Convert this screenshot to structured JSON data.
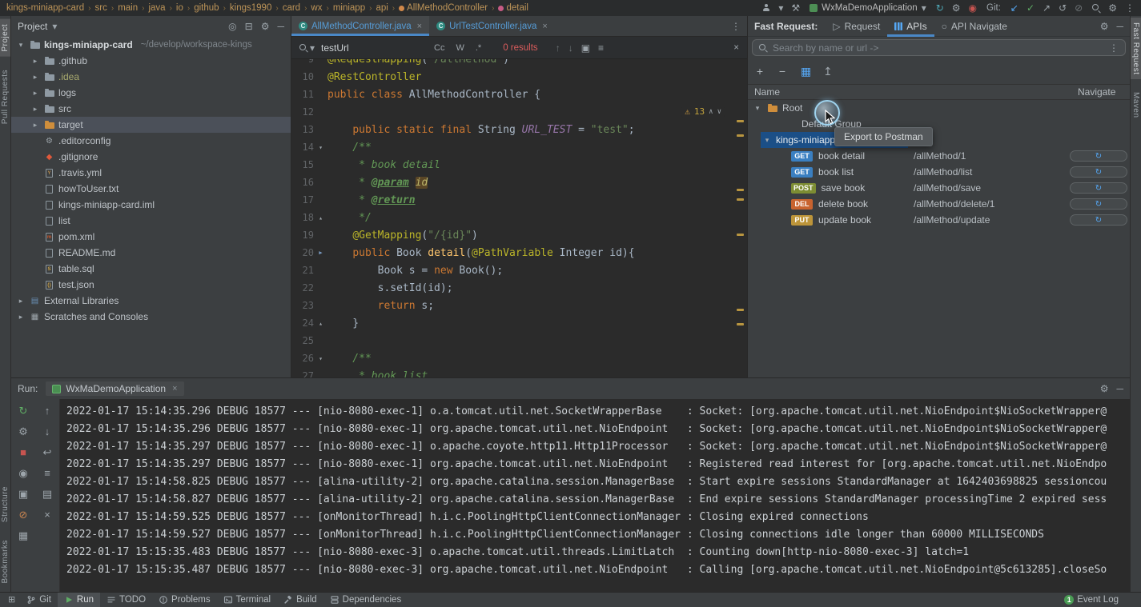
{
  "topbar": {
    "breadcrumbs": [
      {
        "label": "kings-miniapp-card"
      },
      {
        "label": "src"
      },
      {
        "label": "main"
      },
      {
        "label": "java"
      },
      {
        "label": "io"
      },
      {
        "label": "github"
      },
      {
        "label": "kings1990"
      },
      {
        "label": "card"
      },
      {
        "label": "wx"
      },
      {
        "label": "miniapp"
      },
      {
        "label": "api"
      },
      {
        "label": "AllMethodController",
        "dot": "#d0884a"
      },
      {
        "label": "detail",
        "dot": "#c75b84"
      }
    ],
    "run_config": "WxMaDemoApplication",
    "git_label": "Git:",
    "icons_before": [
      {
        "name": "user-icon",
        "shape": "user"
      },
      {
        "name": "chevron-down-icon",
        "glyph": "▾",
        "color": "#9da5ab"
      },
      {
        "name": "build-hammer-icon",
        "glyph": "⚒",
        "color": "#9da5ab"
      }
    ],
    "icons_after": [
      {
        "name": "sync-icon",
        "glyph": "↻",
        "color": "#4ea7b5"
      },
      {
        "name": "services-icon",
        "glyph": "⚙",
        "color": "#9da5ab"
      },
      {
        "name": "profiler-icon",
        "glyph": "◉",
        "color": "#c75450"
      }
    ],
    "git_icons": [
      {
        "name": "git-update-icon",
        "glyph": "↙",
        "color": "#56a8f5"
      },
      {
        "name": "git-commit-icon",
        "glyph": "✓",
        "color": "#5fad65"
      },
      {
        "name": "git-push-icon",
        "glyph": "↗",
        "color": "#9da5ab"
      },
      {
        "name": "git-rollback-icon",
        "glyph": "↺",
        "color": "#9da5ab"
      },
      {
        "name": "git-shelve-icon",
        "glyph": "⊘",
        "color": "#6e7477"
      }
    ],
    "far_icons": [
      {
        "name": "search-icon",
        "shape": "search"
      },
      {
        "name": "settings-icon",
        "glyph": "⚙",
        "color": "#9da5ab"
      },
      {
        "name": "menu-kebab-icon",
        "glyph": "⋮",
        "color": "#9da5ab"
      }
    ]
  },
  "left_strip": {
    "top": [
      {
        "label": "Project",
        "active": true
      },
      {
        "label": "Pull Requests"
      }
    ],
    "bottom": [
      {
        "label": "Structure"
      },
      {
        "label": "Bookmarks"
      }
    ]
  },
  "right_strip": {
    "top": [
      {
        "label": "Fast Request",
        "active": true
      },
      {
        "label": "Maven"
      }
    ]
  },
  "project": {
    "title": "Project",
    "header_icons": [
      {
        "name": "locate-file-icon",
        "glyph": "◎",
        "color": "#9da5ab"
      },
      {
        "name": "collapse-all-icon",
        "glyph": "⊟",
        "color": "#9da5ab"
      },
      {
        "name": "settings-icon",
        "glyph": "⚙",
        "color": "#9da5ab"
      },
      {
        "name": "hide-panel-icon",
        "glyph": "─",
        "color": "#9da5ab"
      }
    ],
    "items": [
      {
        "label": "kings-miniapp-card",
        "path": "~/develop/workspace-kings",
        "icon": "folder",
        "iconColor": "#8f9aa3",
        "chevron": true,
        "open": true,
        "indent": 0,
        "bold": true
      },
      {
        "label": ".github",
        "icon": "folder",
        "chevron": true,
        "indent": 1
      },
      {
        "label": ".idea",
        "icon": "folder",
        "chevron": true,
        "indent": 1,
        "labelColor": "#a8a96e"
      },
      {
        "label": "logs",
        "icon": "folder",
        "chevron": true,
        "indent": 1
      },
      {
        "label": "src",
        "icon": "folder",
        "chevron": true,
        "indent": 1
      },
      {
        "label": "target",
        "icon": "folder",
        "iconColor": "#cf8e3c",
        "chevron": true,
        "indent": 1,
        "selected": true
      },
      {
        "label": ".editorconfig",
        "icon": "gear",
        "indent": 1
      },
      {
        "label": ".gitignore",
        "icon": "git",
        "indent": 1
      },
      {
        "label": ".travis.yml",
        "icon": "file",
        "letter": "Y",
        "letterColor": "#b5894a",
        "indent": 1
      },
      {
        "label": "howToUser.txt",
        "icon": "file",
        "indent": 1
      },
      {
        "label": "kings-miniapp-card.iml",
        "icon": "file",
        "indent": 1
      },
      {
        "label": "list",
        "icon": "file",
        "indent": 1
      },
      {
        "label": "pom.xml",
        "icon": "file",
        "letter": "m",
        "letterColor": "#cc5629",
        "indent": 1
      },
      {
        "label": "README.md",
        "icon": "file",
        "indent": 1
      },
      {
        "label": "table.sql",
        "icon": "file",
        "letter": "S",
        "letterColor": "#c9a24a",
        "indent": 1
      },
      {
        "label": "test.json",
        "icon": "file",
        "letter": "{}",
        "letterColor": "#c9a24a",
        "indent": 1
      },
      {
        "label": "External Libraries",
        "icon": "lib",
        "chevron": true,
        "indent": 0
      },
      {
        "label": "Scratches and Consoles",
        "icon": "scratch",
        "chevron": true,
        "indent": 0
      }
    ]
  },
  "editor": {
    "tabs": [
      {
        "label": "AllMethodController.java",
        "active": true
      },
      {
        "label": "UrlTestController.java",
        "active": false
      }
    ],
    "find": {
      "query": "testUrl",
      "match_case": "Cc",
      "words": "W",
      "regex": ".*",
      "results": "0 results"
    },
    "find_icons_left": [
      {
        "name": "search-icon",
        "shape": "search"
      },
      {
        "name": "search-history-icon",
        "glyph": "▾",
        "color": "#9da5ab"
      }
    ],
    "find_icons_right": [
      {
        "name": "prev-match-icon",
        "glyph": "↑",
        "color": "#6e7478"
      },
      {
        "name": "next-match-icon",
        "glyph": "↓",
        "color": "#6e7478"
      },
      {
        "name": "find-in-selection-icon",
        "glyph": "▣",
        "color": "#9da5ab"
      },
      {
        "name": "filter-icon",
        "glyph": "≡",
        "color": "#9da5ab"
      }
    ],
    "inspection_count": "13",
    "stripe_marks": [
      76,
      94,
      162,
      174,
      218,
      312,
      330
    ],
    "code": [
      {
        "n": 9,
        "seg": [
          [
            "@RequestMapping",
            "ann"
          ],
          [
            "(",
            "pl"
          ],
          [
            "\"/allMethod\"",
            "str"
          ],
          [
            ")",
            "pl"
          ]
        ]
      },
      {
        "n": 10,
        "seg": [
          [
            "@RestController",
            "ann"
          ]
        ]
      },
      {
        "n": 11,
        "seg": [
          [
            "public class ",
            "kw"
          ],
          [
            "AllMethodController {",
            "pl"
          ]
        ]
      },
      {
        "n": 12,
        "seg": []
      },
      {
        "n": 13,
        "seg": [
          [
            "    ",
            "pl"
          ],
          [
            "public static final ",
            "kw"
          ],
          [
            "String ",
            "pl"
          ],
          [
            "URL_TEST",
            "fld"
          ],
          [
            " = ",
            "pl"
          ],
          [
            "\"test\"",
            "str"
          ],
          [
            ";",
            "pl"
          ]
        ]
      },
      {
        "n": 14,
        "f": "v",
        "seg": [
          [
            "    /**",
            "cmt"
          ]
        ]
      },
      {
        "n": 15,
        "seg": [
          [
            "     * book detail",
            "cmt"
          ]
        ]
      },
      {
        "n": 16,
        "seg": [
          [
            "     * ",
            "cmt"
          ],
          [
            "@param",
            "tag"
          ],
          [
            " ",
            "cmt"
          ],
          [
            "id",
            "idhl"
          ]
        ]
      },
      {
        "n": 17,
        "seg": [
          [
            "     * ",
            "cmt"
          ],
          [
            "@return",
            "tag"
          ]
        ]
      },
      {
        "n": 18,
        "f": "^",
        "seg": [
          [
            "     */",
            "cmt"
          ]
        ]
      },
      {
        "n": 19,
        "seg": [
          [
            "    ",
            "pl"
          ],
          [
            "@GetMapping",
            "ann"
          ],
          [
            "(",
            "pl"
          ],
          [
            "\"/{id}\"",
            "str"
          ],
          [
            ")",
            "pl"
          ]
        ]
      },
      {
        "n": 20,
        "m": "api",
        "seg": [
          [
            "    ",
            "pl"
          ],
          [
            "public ",
            "kw"
          ],
          [
            "Book ",
            "pl"
          ],
          [
            "detail",
            "mth"
          ],
          [
            "(",
            "pl"
          ],
          [
            "@PathVariable",
            "ann"
          ],
          [
            " Integer id){",
            "pl"
          ]
        ]
      },
      {
        "n": 21,
        "seg": [
          [
            "        Book s = ",
            "pl"
          ],
          [
            "new ",
            "kw"
          ],
          [
            "Book();",
            "pl"
          ]
        ]
      },
      {
        "n": 22,
        "seg": [
          [
            "        s.setId(id);",
            "pl"
          ]
        ]
      },
      {
        "n": 23,
        "seg": [
          [
            "        ",
            "pl"
          ],
          [
            "return ",
            "kw"
          ],
          [
            "s;",
            "pl"
          ]
        ]
      },
      {
        "n": 24,
        "f": "^",
        "seg": [
          [
            "    }",
            "pl"
          ]
        ]
      },
      {
        "n": 25,
        "seg": []
      },
      {
        "n": 26,
        "f": "v",
        "seg": [
          [
            "    /**",
            "cmt"
          ]
        ]
      },
      {
        "n": 27,
        "seg": [
          [
            "     * book list",
            "cmt"
          ]
        ]
      }
    ]
  },
  "fast_request": {
    "title": "Fast Request:",
    "tabs": [
      {
        "label": "Request",
        "icon": "request"
      },
      {
        "label": "APIs",
        "icon": "apis",
        "active": true
      },
      {
        "label": "API Navigate",
        "icon": "navigate"
      }
    ],
    "header_icons": [
      {
        "name": "settings-icon",
        "glyph": "⚙",
        "color": "#9da5ab"
      },
      {
        "name": "hide-panel-icon",
        "glyph": "─",
        "color": "#9da5ab"
      }
    ],
    "search_placeholder": "Search by name or url ->",
    "toolbar": [
      {
        "name": "add-icon",
        "glyph": "+",
        "color": "#afb6bb"
      },
      {
        "name": "remove-icon",
        "glyph": "−",
        "color": "#afb6bb"
      },
      {
        "name": "table-view-icon",
        "glyph": "▦",
        "color": "#56a8f5"
      },
      {
        "name": "export-postman-icon",
        "glyph": "↥",
        "color": "#9da5ab"
      }
    ],
    "tooltip": "Export to Postman",
    "columns": {
      "name": "Name",
      "navigate": "Navigate"
    },
    "tree": [
      {
        "label": "Root",
        "chevron": "▾",
        "icon": "folder",
        "pad": 6
      },
      {
        "label": "Default Group",
        "pad": 50
      },
      {
        "label": "kings-miniapp-card",
        "chevron": "▾",
        "pad": 18,
        "selected": true
      }
    ],
    "apis": [
      {
        "method": "GET",
        "color": "#3a7fc1",
        "name": "book detail",
        "url": "/allMethod/1"
      },
      {
        "method": "GET",
        "color": "#3a7fc1",
        "name": "book list",
        "url": "/allMethod/list"
      },
      {
        "method": "POST",
        "color": "#7d8d33",
        "name": "save book",
        "url": "/allMethod/save"
      },
      {
        "method": "DEL",
        "color": "#c8632f",
        "name": "delete book",
        "url": "/allMethod/delete/1"
      },
      {
        "method": "PUT",
        "color": "#bd953a",
        "name": "update book",
        "url": "/allMethod/update"
      }
    ]
  },
  "run_panel": {
    "title": "Run:",
    "tab": "WxMaDemoApplication",
    "header_icons": [
      {
        "name": "settings-icon",
        "glyph": "⚙",
        "color": "#9da5ab"
      },
      {
        "name": "hide-panel-icon",
        "glyph": "─",
        "color": "#9da5ab"
      }
    ],
    "left_icons": [
      {
        "name": "rerun-icon",
        "glyph": "↻",
        "color": "#5fad65"
      },
      {
        "name": "edit-config-icon",
        "glyph": "⚙",
        "color": "#9da5ab"
      },
      {
        "name": "stop-icon",
        "glyph": "■",
        "color": "#c75450"
      },
      {
        "name": "dump-threads-icon",
        "glyph": "◉",
        "color": "#9da5ab"
      },
      {
        "name": "coverage-icon",
        "glyph": "▣",
        "color": "#9da5ab"
      },
      {
        "name": "exit-icon",
        "glyph": "⊘",
        "color": "#c78450"
      },
      {
        "name": "layout-icon",
        "glyph": "▦",
        "color": "#9da5ab"
      }
    ],
    "right_icons": [
      {
        "name": "scroll-up-icon",
        "glyph": "↑",
        "color": "#9da5ab"
      },
      {
        "name": "scroll-down-icon",
        "glyph": "↓",
        "color": "#9da5ab"
      },
      {
        "name": "soft-wrap-icon",
        "glyph": "↩",
        "color": "#9da5ab"
      },
      {
        "name": "scroll-end-icon",
        "glyph": "≡",
        "color": "#9da5ab"
      },
      {
        "name": "print-icon",
        "glyph": "▤",
        "color": "#9da5ab"
      },
      {
        "name": "clear-output-icon",
        "glyph": "×",
        "color": "#9da5ab"
      }
    ],
    "console": [
      "2022-01-17 15:14:35.296 DEBUG 18577 --- [nio-8080-exec-1] o.a.tomcat.util.net.SocketWrapperBase    : Socket: [org.apache.tomcat.util.net.NioEndpoint$NioSocketWrapper@",
      "2022-01-17 15:14:35.296 DEBUG 18577 --- [nio-8080-exec-1] org.apache.tomcat.util.net.NioEndpoint   : Socket: [org.apache.tomcat.util.net.NioEndpoint$NioSocketWrapper@",
      "2022-01-17 15:14:35.297 DEBUG 18577 --- [nio-8080-exec-1] o.apache.coyote.http11.Http11Processor   : Socket: [org.apache.tomcat.util.net.NioEndpoint$NioSocketWrapper@",
      "2022-01-17 15:14:35.297 DEBUG 18577 --- [nio-8080-exec-1] org.apache.tomcat.util.net.NioEndpoint   : Registered read interest for [org.apache.tomcat.util.net.NioEndpo",
      "2022-01-17 15:14:58.825 DEBUG 18577 --- [alina-utility-2] org.apache.catalina.session.ManagerBase  : Start expire sessions StandardManager at 1642403698825 sessioncou",
      "2022-01-17 15:14:58.827 DEBUG 18577 --- [alina-utility-2] org.apache.catalina.session.ManagerBase  : End expire sessions StandardManager processingTime 2 expired sess",
      "2022-01-17 15:14:59.525 DEBUG 18577 --- [onMonitorThread] h.i.c.PoolingHttpClientConnectionManager : Closing expired connections",
      "2022-01-17 15:14:59.527 DEBUG 18577 --- [onMonitorThread] h.i.c.PoolingHttpClientConnectionManager : Closing connections idle longer than 60000 MILLISECONDS",
      "2022-01-17 15:15:35.483 DEBUG 18577 --- [nio-8080-exec-3] o.apache.tomcat.util.threads.LimitLatch  : Counting down[http-nio-8080-exec-3] latch=1",
      "2022-01-17 15:15:35.487 DEBUG 18577 --- [nio-8080-exec-3] org.apache.tomcat.util.net.NioEndpoint   : Calling [org.apache.tomcat.util.net.NioEndpoint@5c613285].closeSo"
    ]
  },
  "status_bar": {
    "left": [
      {
        "label": "Git",
        "icon": "git"
      },
      {
        "label": "Run",
        "icon": "run",
        "active": true
      },
      {
        "label": "TODO",
        "icon": "todo"
      },
      {
        "label": "Problems",
        "icon": "problems"
      },
      {
        "label": "Terminal",
        "icon": "terminal"
      },
      {
        "label": "Build",
        "icon": "build"
      },
      {
        "label": "Dependencies",
        "icon": "dependencies"
      }
    ],
    "right": [
      {
        "label": "Event Log",
        "icon": "eventlog",
        "badge": "1"
      }
    ]
  }
}
